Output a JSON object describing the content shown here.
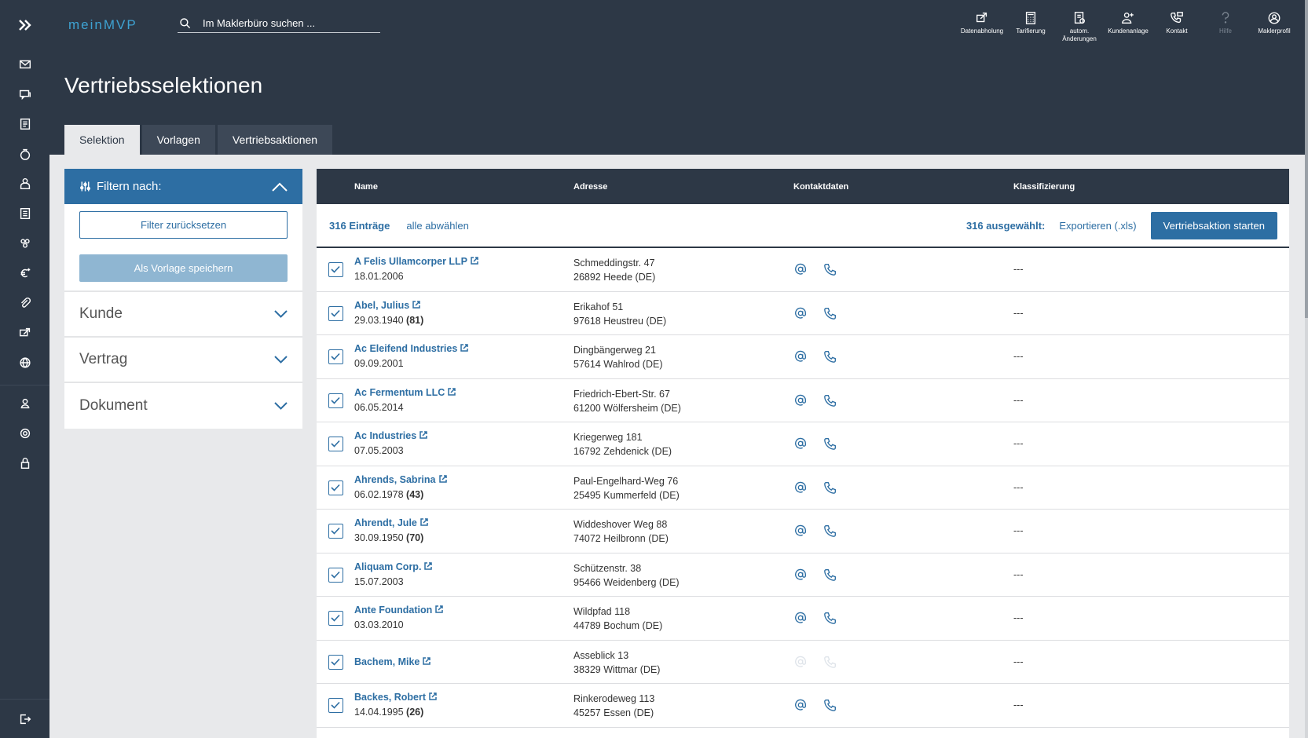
{
  "brand": "meinMVP",
  "search": {
    "placeholder": "Im Maklerbüro suchen ..."
  },
  "header_actions": [
    {
      "icon": "data-fetch-icon",
      "label": "Datenabholung",
      "muted": false
    },
    {
      "icon": "calculator-icon",
      "label": "Tarifierung",
      "muted": false
    },
    {
      "icon": "auto-change-icon",
      "label": "autom. Änderungen",
      "muted": false
    },
    {
      "icon": "add-customer-icon",
      "label": "Kundenanlage",
      "muted": false
    },
    {
      "icon": "contact-icon",
      "label": "Kontakt",
      "muted": false
    },
    {
      "icon": "help-icon",
      "label": "Hilfe",
      "muted": true
    },
    {
      "icon": "broker-profile-icon",
      "label": "Maklerprofil",
      "muted": false
    }
  ],
  "page_title": "Vertriebsselektionen",
  "tabs": [
    {
      "label": "Selektion",
      "active": true
    },
    {
      "label": "Vorlagen",
      "active": false
    },
    {
      "label": "Vertriebsaktionen",
      "active": false
    }
  ],
  "filter": {
    "title": "Filtern nach:",
    "reset_label": "Filter zurücksetzen",
    "save_template_label": "Als Vorlage speichern",
    "sections": [
      "Kunde",
      "Vertrag",
      "Dokument"
    ]
  },
  "table": {
    "columns": [
      "Name",
      "Adresse",
      "Kontaktdaten",
      "Klassifizierung"
    ],
    "entries_count": "316",
    "entries_label": "Einträge",
    "deselect_all": "alle abwählen",
    "selected_count": "316",
    "selected_label": "ausgewählt:",
    "export_label": "Exportieren (.xls)",
    "start_action_label": "Vertriebsaktion starten",
    "rows": [
      {
        "name": "A Felis Ullamcorper LLP",
        "date": "18.01.2006",
        "age": "",
        "street": "Schmeddingstr. 47",
        "city": "26892 Heede (DE)",
        "contact": true,
        "class": "---"
      },
      {
        "name": "Abel, Julius",
        "date": "29.03.1940",
        "age": "(81)",
        "street": "Erikahof 51",
        "city": "97618 Heustreu (DE)",
        "contact": true,
        "class": "---"
      },
      {
        "name": "Ac Eleifend Industries",
        "date": "09.09.2001",
        "age": "",
        "street": "Dingbängerweg 21",
        "city": "57614 Wahlrod (DE)",
        "contact": true,
        "class": "---"
      },
      {
        "name": "Ac Fermentum LLC",
        "date": "06.05.2014",
        "age": "",
        "street": "Friedrich-Ebert-Str. 67",
        "city": "61200 Wölfersheim (DE)",
        "contact": true,
        "class": "---"
      },
      {
        "name": "Ac Industries",
        "date": "07.05.2003",
        "age": "",
        "street": "Kriegerweg 181",
        "city": "16792 Zehdenick (DE)",
        "contact": true,
        "class": "---"
      },
      {
        "name": "Ahrends, Sabrina",
        "date": "06.02.1978",
        "age": "(43)",
        "street": "Paul-Engelhard-Weg 76",
        "city": "25495 Kummerfeld (DE)",
        "contact": true,
        "class": "---"
      },
      {
        "name": "Ahrendt, Jule",
        "date": "30.09.1950",
        "age": "(70)",
        "street": "Widdeshover Weg 88",
        "city": "74072 Heilbronn (DE)",
        "contact": true,
        "class": "---"
      },
      {
        "name": "Aliquam Corp.",
        "date": "15.07.2003",
        "age": "",
        "street": "Schützenstr. 38",
        "city": "95466 Weidenberg (DE)",
        "contact": true,
        "class": "---"
      },
      {
        "name": "Ante Foundation",
        "date": "03.03.2010",
        "age": "",
        "street": "Wildpfad 118",
        "city": "44789 Bochum (DE)",
        "contact": true,
        "class": "---"
      },
      {
        "name": "Bachem, Mike",
        "date": "",
        "age": "",
        "street": "Asseblick 13",
        "city": "38329 Wittmar (DE)",
        "contact": false,
        "class": "---"
      },
      {
        "name": "Backes, Robert",
        "date": "14.04.1995",
        "age": "(26)",
        "street": "Rinkerodeweg 113",
        "city": "45257 Essen (DE)",
        "contact": true,
        "class": "---"
      }
    ]
  },
  "colors": {
    "dark": "#2d3846",
    "accent": "#2d6ea3",
    "brand": "#3ea2d2"
  }
}
